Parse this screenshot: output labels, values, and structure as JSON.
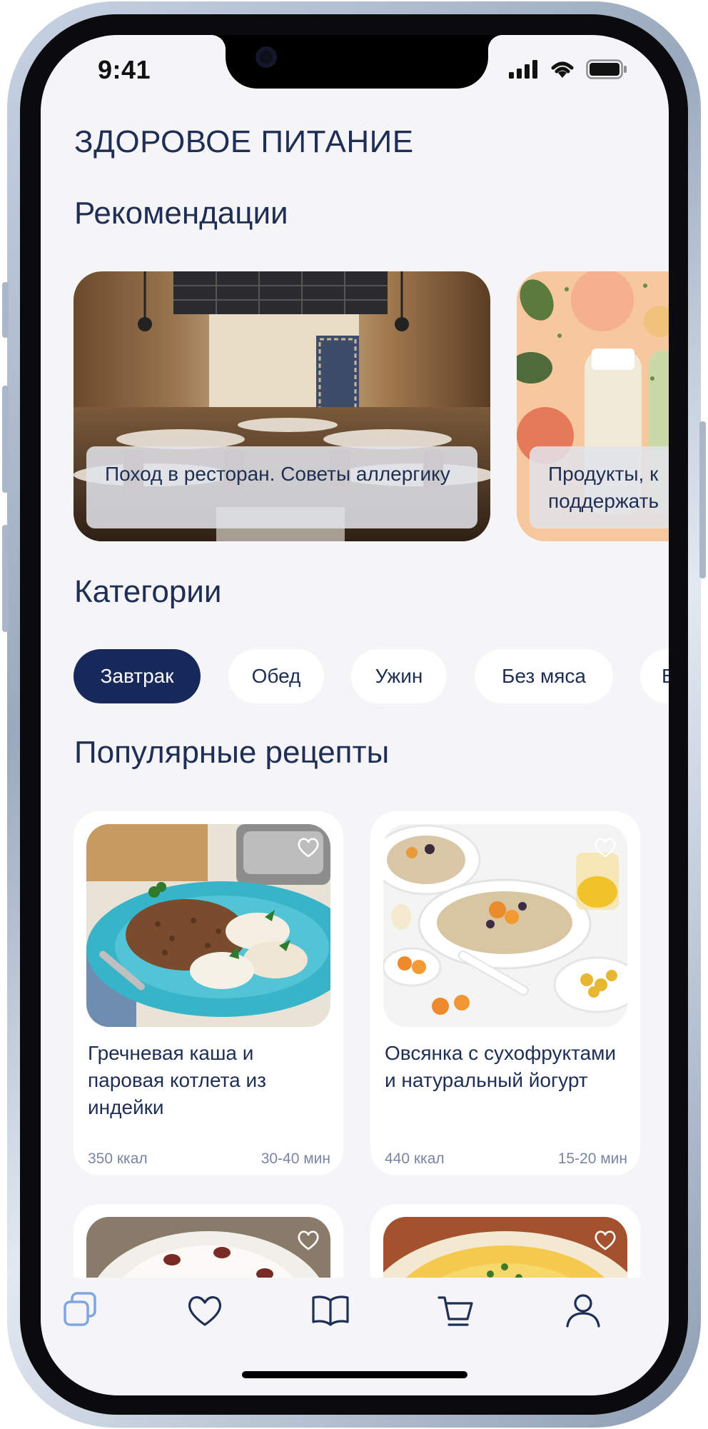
{
  "status_bar": {
    "time": "9:41"
  },
  "header": {
    "title": "ЗДОРОВОЕ ПИТАНИЕ"
  },
  "recommendations": {
    "heading": "Рекомендации",
    "cards": [
      {
        "caption": "Поход в ресторан. Советы аллергику"
      },
      {
        "caption": "Продукты, к\nподдержать"
      }
    ]
  },
  "categories": {
    "heading": "Категории",
    "chips": [
      "Завтрак",
      "Обед",
      "Ужин",
      "Без мяса",
      "Б"
    ],
    "selected": "Завтрак"
  },
  "popular": {
    "heading": "Популярные рецепты",
    "recipes": [
      {
        "title": "Гречневая каша и паровая котлета из индейки",
        "kcal": "350 ккал",
        "time": "30-40 мин"
      },
      {
        "title": "Овсянка с сухофруктами и натуральный йогурт",
        "kcal": "440 ккал",
        "time": "15-20 мин"
      }
    ]
  },
  "tabbar": {
    "tabs": [
      "home-icon",
      "favorites-heart-icon",
      "recipes-book-icon",
      "cart-icon",
      "profile-icon"
    ],
    "active": "home-icon"
  },
  "colors": {
    "primary": "#17295a",
    "text": "#1f2e54",
    "muted": "#7b85a0",
    "accent_tab": "#7fa6df",
    "background": "#f5f5f8"
  }
}
